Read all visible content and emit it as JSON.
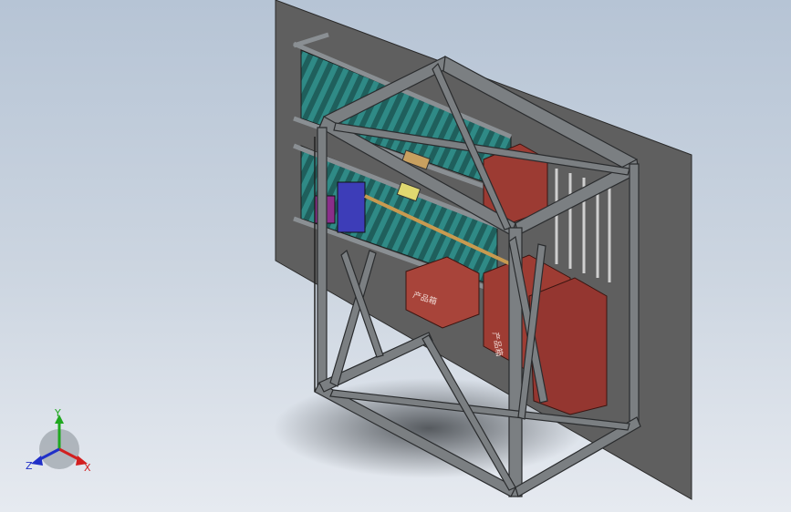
{
  "view": {
    "background_top": "#b6c4d5",
    "background_bottom": "#e6eaf0",
    "wall_color": "#5d5d5d",
    "frame_color": "#7b7f82",
    "roller_color": "#2f8a86",
    "box_color": "#9c3b33"
  },
  "triad": {
    "y_label": "Y",
    "z_label": "Z",
    "x_label": "X",
    "y_color": "#1fa81f",
    "x_color": "#d21f1f",
    "z_color": "#2030c8"
  },
  "box_labels": {
    "front": "产品箱",
    "side": "产品箱"
  }
}
